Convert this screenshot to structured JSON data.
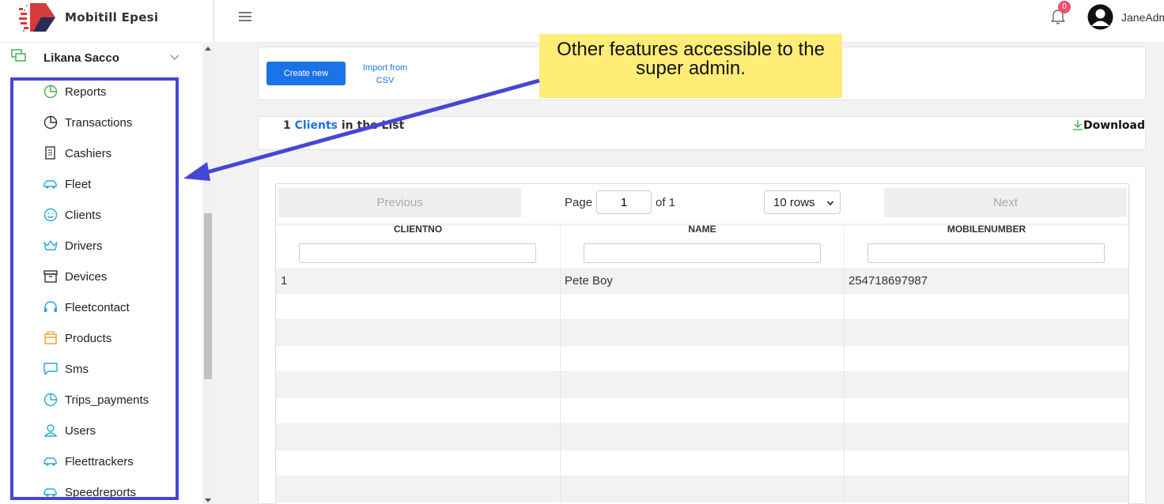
{
  "brand": {
    "name": "Mobitill Epesi"
  },
  "org": {
    "name": "Likana Sacco"
  },
  "menu": [
    {
      "label": "Reports",
      "icon": "pie-chart-icon"
    },
    {
      "label": "Transactions",
      "icon": "pie-chart-icon"
    },
    {
      "label": "Cashiers",
      "icon": "receipt-icon"
    },
    {
      "label": "Fleet",
      "icon": "car-icon"
    },
    {
      "label": "Clients",
      "icon": "smile-icon"
    },
    {
      "label": "Drivers",
      "icon": "crown-icon"
    },
    {
      "label": "Devices",
      "icon": "archive-icon"
    },
    {
      "label": "Fleetcontact",
      "icon": "headset-icon"
    },
    {
      "label": "Products",
      "icon": "box-icon"
    },
    {
      "label": "Sms",
      "icon": "message-icon"
    },
    {
      "label": "Trips_payments",
      "icon": "pie-chart-icon"
    },
    {
      "label": "Users",
      "icon": "user-icon"
    },
    {
      "label": "Fleettrackers",
      "icon": "car-icon"
    },
    {
      "label": "Speedreports",
      "icon": "car-icon"
    }
  ],
  "topbar": {
    "notifications": "0",
    "username": "JaneAdmin"
  },
  "actions": {
    "create_label": "Create new",
    "import_label": "Import from CSV"
  },
  "summary": {
    "count": "1",
    "entity": "Clients",
    "suffix": "in the List",
    "download_label": "Download"
  },
  "pager": {
    "previous": "Previous",
    "page_label": "Page",
    "page_value": "1",
    "of_label": "of 1",
    "rows_option": "10 rows",
    "next": "Next"
  },
  "table": {
    "columns": [
      "CLIENTNO",
      "NAME",
      "MOBILENUMBER"
    ],
    "rows": [
      [
        "1",
        "Pete Boy",
        "254718697987"
      ]
    ]
  },
  "annotation": {
    "text": "Other features accessible to the super admin."
  },
  "colors": {
    "accent": "#1a73e8",
    "highlight_box": "#4646d6",
    "callout": "#ffed77",
    "badge": "#f0506e"
  }
}
